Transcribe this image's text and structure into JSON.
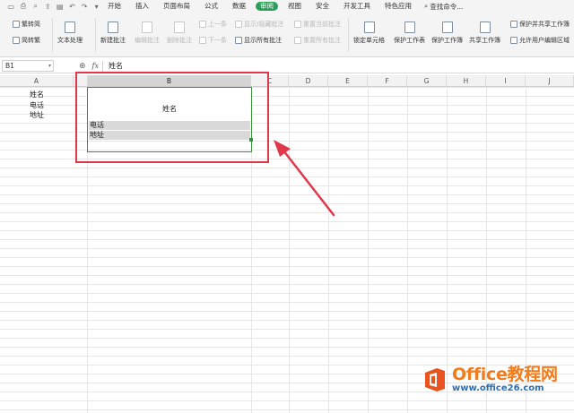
{
  "quick_access_icons": [
    "save-icon",
    "print-icon",
    "print-preview-icon",
    "share-icon",
    "export-icon",
    "undo-icon",
    "redo-icon",
    "more-icon"
  ],
  "menu": {
    "tabs": [
      "开始",
      "插入",
      "页面布局",
      "公式",
      "数据",
      "审阅",
      "视图",
      "安全",
      "开发工具",
      "特色应用"
    ],
    "active_tab": "审阅",
    "search_label": "查找命令..."
  },
  "ribbon": {
    "trad_to_simp": "繁转简",
    "simp_to_trad": "简转繁",
    "text_process": "文本处理",
    "new_comment": "新建批注",
    "edit_comment": "编辑批注",
    "delete_comment": "删除批注",
    "prev_item": "上一条",
    "next_item": "下一条",
    "show_hide_comment": "显示/隐藏批注",
    "show_all_comments": "显示所有批注",
    "reset_current_comment": "重置当前批注",
    "reset_all_comments": "重置所有批注",
    "lock_cell": "锁定单元格",
    "protect_sheet": "保护工作表",
    "protect_workbook": "保护工作簿",
    "share_workbook": "共享工作簿",
    "protect_and_share": "保护并共享工作簿",
    "allow_edit_ranges": "允许用户编辑区域"
  },
  "formula_bar": {
    "cell_ref": "B1",
    "formula": "姓名"
  },
  "grid": {
    "columns": [
      "A",
      "B",
      "C",
      "D",
      "E",
      "F",
      "G",
      "H",
      "I",
      "J"
    ],
    "selected_column": "B",
    "colA_lines": [
      "姓名",
      "电话",
      "地址"
    ],
    "b_cell": "姓名",
    "b_row2": "电话",
    "b_row3": "地址"
  },
  "colors": {
    "active_tab": "#2c9e5a",
    "selection": "#3a8f3a",
    "highlight": "#e0384a"
  },
  "watermark": {
    "brand": "Office教程网",
    "url": "www.office26.com"
  }
}
